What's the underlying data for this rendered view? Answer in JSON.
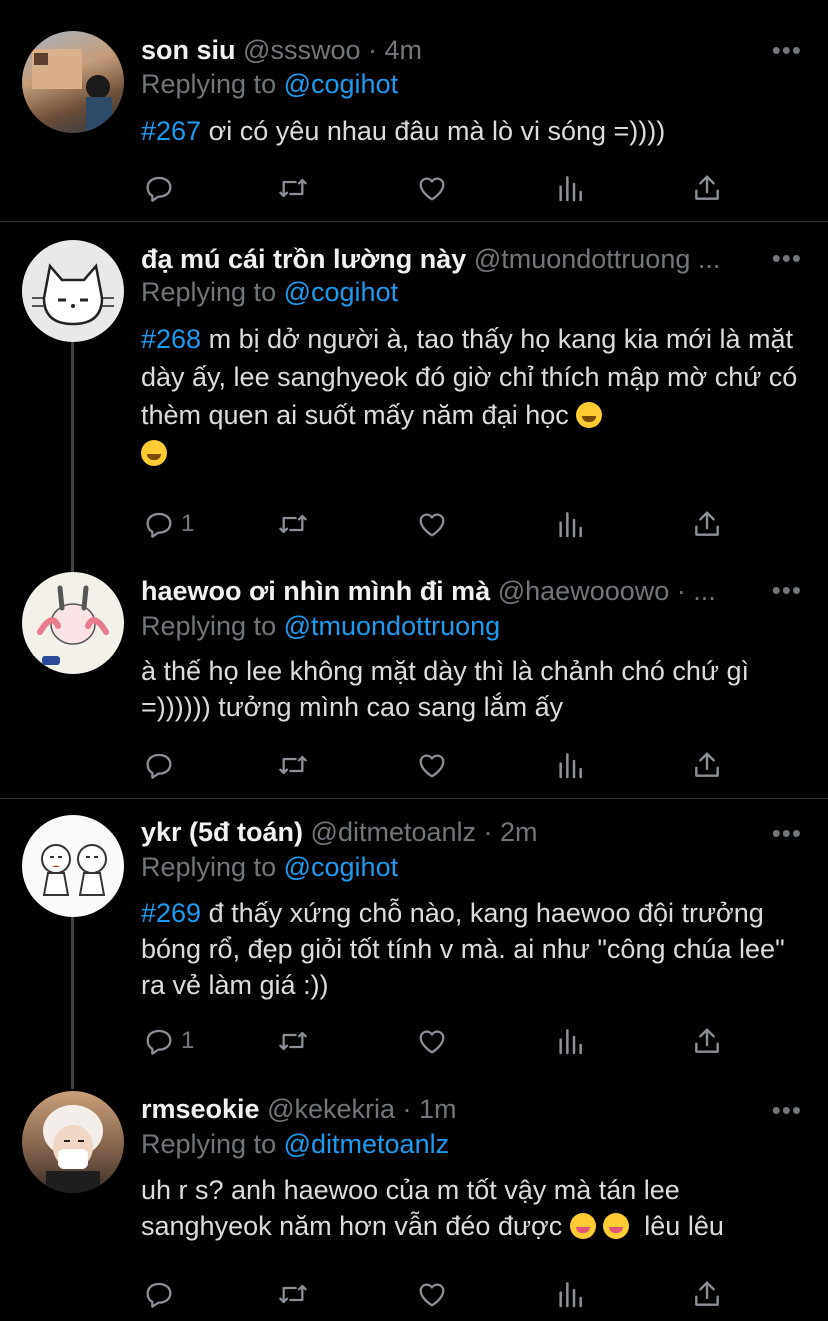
{
  "colors": {
    "background": "#000000",
    "link": "#1d9bf0",
    "muted": "#71767b",
    "text": "#dcdcdc"
  },
  "icons": [
    "reply-icon",
    "retweet-icon",
    "like-icon",
    "views-icon",
    "share-icon",
    "more-icon"
  ],
  "tweets": [
    {
      "name": "son siu",
      "handle": "@ssswoo · 4m",
      "replying_prefix": "Replying to",
      "replying_to": "@cogihot",
      "tag": "#267",
      "text": " ơi có yêu nhau đâu mà lò vi sóng =))))",
      "reply_count": ""
    },
    {
      "name": "đạ mú cái trồn lường này",
      "handle": "@tmuondottruong ...",
      "replying_prefix": "Replying to",
      "replying_to": "@cogihot",
      "tag": "#268",
      "text": " m bị dở người à, tao thấy họ kang kia mới là mặt dày ấy, lee sanghyeok đó giờ chỉ thích mập mờ chứ có thèm quen ai suốt mấy năm đại học",
      "reply_count": "1"
    },
    {
      "name": "haewoo ơi nhìn mình đi mà",
      "handle": "@haewooowo · ...",
      "replying_prefix": "Replying to",
      "replying_to": "@tmuondottruong",
      "tag": "",
      "text": "à thế họ lee không mặt dày thì là chảnh chó chứ gì =)))))) tưởng mình cao sang lắm ấy",
      "reply_count": ""
    },
    {
      "name": "ykr (5đ toán)",
      "handle": "@ditmetoanlz · 2m",
      "replying_prefix": "Replying to",
      "replying_to": "@cogihot",
      "tag": "#269",
      "text": " đ thấy xứng chỗ nào, kang haewoo đội trưởng bóng rổ, đẹp giỏi tốt tính v mà. ai như \"công chúa lee\" ra vẻ làm giá :))",
      "reply_count": "1"
    },
    {
      "name": "rmseokie",
      "handle": "@kekekria · 1m",
      "replying_prefix": "Replying to",
      "replying_to": "@ditmetoanlz",
      "tag": "",
      "text": "uh r s? anh haewoo của m tốt vậy mà tán lee sanghyeok năm hơn vẫn đéo được",
      "text_end": "lêu lêu",
      "reply_count": ""
    }
  ]
}
